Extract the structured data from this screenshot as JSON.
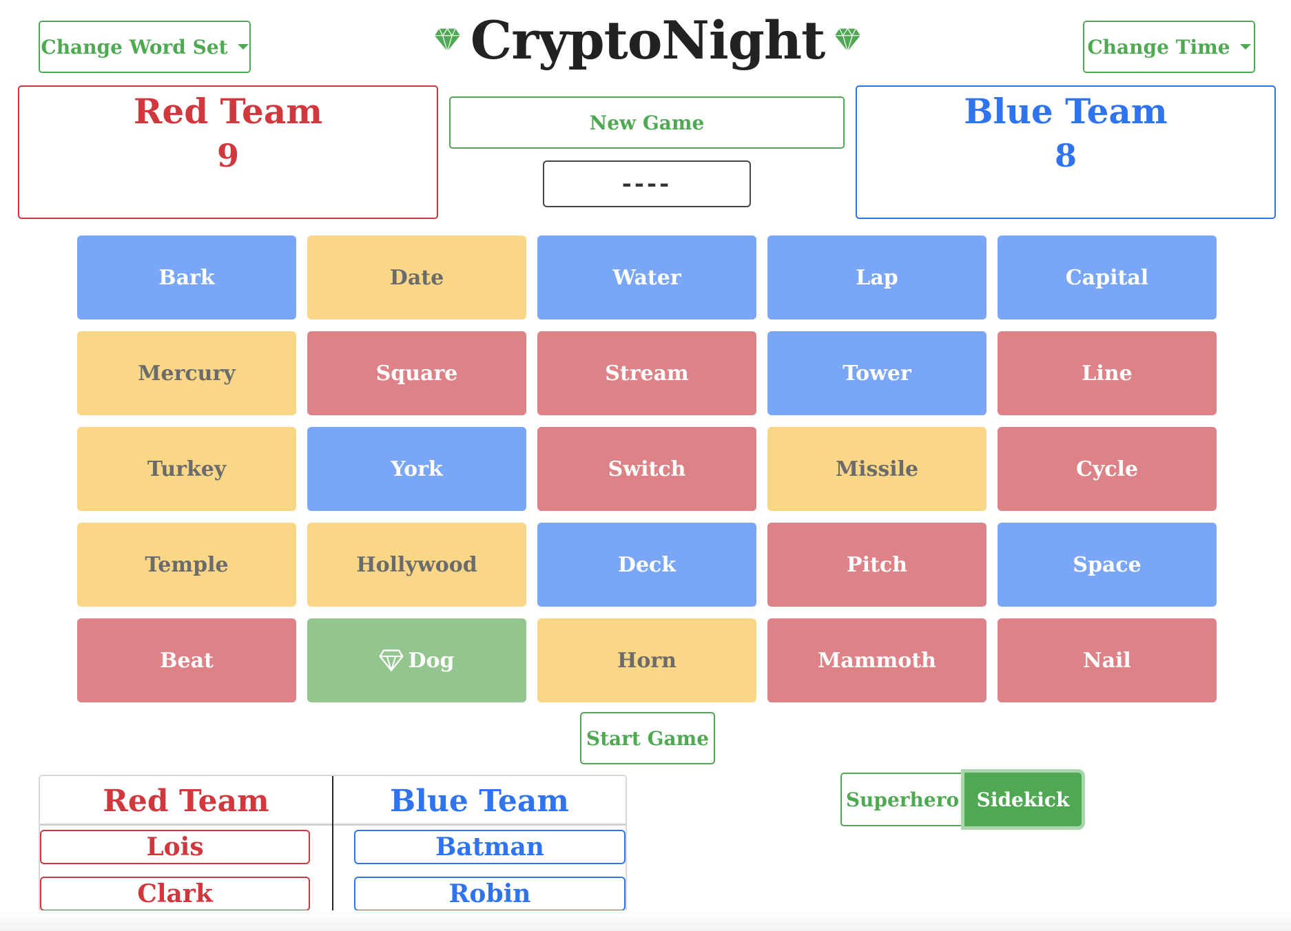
{
  "header": {
    "title": "CryptoNight",
    "word_set_label": "Change Word Set",
    "time_label": "Change Time",
    "new_game_label": "New Game",
    "timer_display": "----"
  },
  "scores": {
    "red": {
      "name": "Red Team",
      "score": "9"
    },
    "blue": {
      "name": "Blue Team",
      "score": "8"
    }
  },
  "board": {
    "cards": [
      {
        "word": "Bark",
        "color": "blue"
      },
      {
        "word": "Date",
        "color": "neutral"
      },
      {
        "word": "Water",
        "color": "blue"
      },
      {
        "word": "Lap",
        "color": "blue"
      },
      {
        "word": "Capital",
        "color": "blue"
      },
      {
        "word": "Mercury",
        "color": "neutral"
      },
      {
        "word": "Square",
        "color": "red"
      },
      {
        "word": "Stream",
        "color": "red"
      },
      {
        "word": "Tower",
        "color": "blue"
      },
      {
        "word": "Line",
        "color": "red"
      },
      {
        "word": "Turkey",
        "color": "neutral"
      },
      {
        "word": "York",
        "color": "blue"
      },
      {
        "word": "Switch",
        "color": "red"
      },
      {
        "word": "Missile",
        "color": "neutral"
      },
      {
        "word": "Cycle",
        "color": "red"
      },
      {
        "word": "Temple",
        "color": "neutral"
      },
      {
        "word": "Hollywood",
        "color": "neutral"
      },
      {
        "word": "Deck",
        "color": "blue"
      },
      {
        "word": "Pitch",
        "color": "red"
      },
      {
        "word": "Space",
        "color": "blue"
      },
      {
        "word": "Beat",
        "color": "red"
      },
      {
        "word": "Dog",
        "color": "assassin",
        "icon": "diamond-icon"
      },
      {
        "word": "Horn",
        "color": "neutral"
      },
      {
        "word": "Mammoth",
        "color": "red"
      },
      {
        "word": "Nail",
        "color": "red"
      }
    ]
  },
  "start_game_label": "Start Game",
  "players": {
    "red_header": "Red Team",
    "blue_header": "Blue Team",
    "red": [
      "Lois",
      "Clark"
    ],
    "blue": [
      "Batman",
      "Robin"
    ]
  },
  "role": {
    "superhero_label": "Superhero",
    "sidekick_label": "Sidekick",
    "selected": "Sidekick"
  },
  "colors": {
    "accent_green": "#4fa852",
    "red_team": "#d0383e",
    "blue_team": "#2f73ee",
    "card_blue": "#7aa6f7",
    "card_red": "#dd8388",
    "card_neutral": "#f9d787",
    "card_assassin": "#93c58e"
  }
}
